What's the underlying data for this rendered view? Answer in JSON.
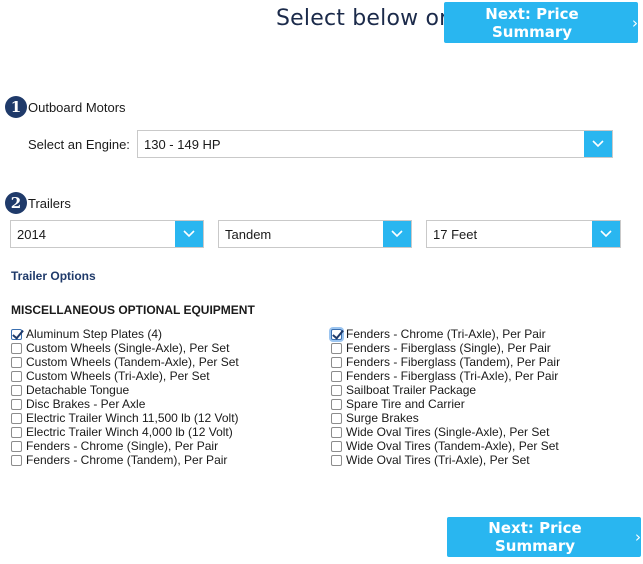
{
  "header": {
    "heading": "Select below or",
    "next_label": "Next: Price Summary"
  },
  "outboard": {
    "step": "1",
    "title": "Outboard Motors",
    "engine_label": "Select an Engine:",
    "engine_value": "130 - 149 HP"
  },
  "trailers": {
    "step": "2",
    "title": "Trailers",
    "year": "2014",
    "axle": "Tandem",
    "length": "17 Feet"
  },
  "trailer_options_label": "Trailer Options",
  "misc_header": "MISCELLANEOUS OPTIONAL EQUIPMENT",
  "options_left": [
    {
      "label": "Aluminum Step Plates (4)",
      "checked": true
    },
    {
      "label": "Custom Wheels (Single-Axle), Per Set",
      "checked": false
    },
    {
      "label": "Custom Wheels (Tandem-Axle), Per Set",
      "checked": false
    },
    {
      "label": "Custom Wheels (Tri-Axle), Per Set",
      "checked": false
    },
    {
      "label": "Detachable Tongue",
      "checked": false
    },
    {
      "label": "Disc Brakes - Per Axle",
      "checked": false
    },
    {
      "label": "Electric Trailer Winch 11,500 lb (12 Volt)",
      "checked": false
    },
    {
      "label": "Electric Trailer Winch 4,000 lb (12 Volt)",
      "checked": false
    },
    {
      "label": "Fenders - Chrome (Single), Per Pair",
      "checked": false
    },
    {
      "label": "Fenders - Chrome (Tandem), Per Pair",
      "checked": false
    }
  ],
  "options_right": [
    {
      "label": "Fenders - Chrome (Tri-Axle), Per Pair",
      "checked": true
    },
    {
      "label": "Fenders - Fiberglass (Single), Per Pair",
      "checked": false
    },
    {
      "label": "Fenders - Fiberglass (Tandem), Per Pair",
      "checked": false
    },
    {
      "label": "Fenders - Fiberglass (Tri-Axle), Per Pair",
      "checked": false
    },
    {
      "label": "Sailboat Trailer Package",
      "checked": false
    },
    {
      "label": "Spare Tire and Carrier",
      "checked": false
    },
    {
      "label": "Surge Brakes",
      "checked": false
    },
    {
      "label": "Wide Oval Tires (Single-Axle), Per Set",
      "checked": false
    },
    {
      "label": "Wide Oval Tires (Tandem-Axle), Per Set",
      "checked": false
    },
    {
      "label": "Wide Oval Tires (Tri-Axle), Per Set",
      "checked": false
    }
  ],
  "colors": {
    "accent": "#29b6f0",
    "navy": "#1f3a6a"
  }
}
